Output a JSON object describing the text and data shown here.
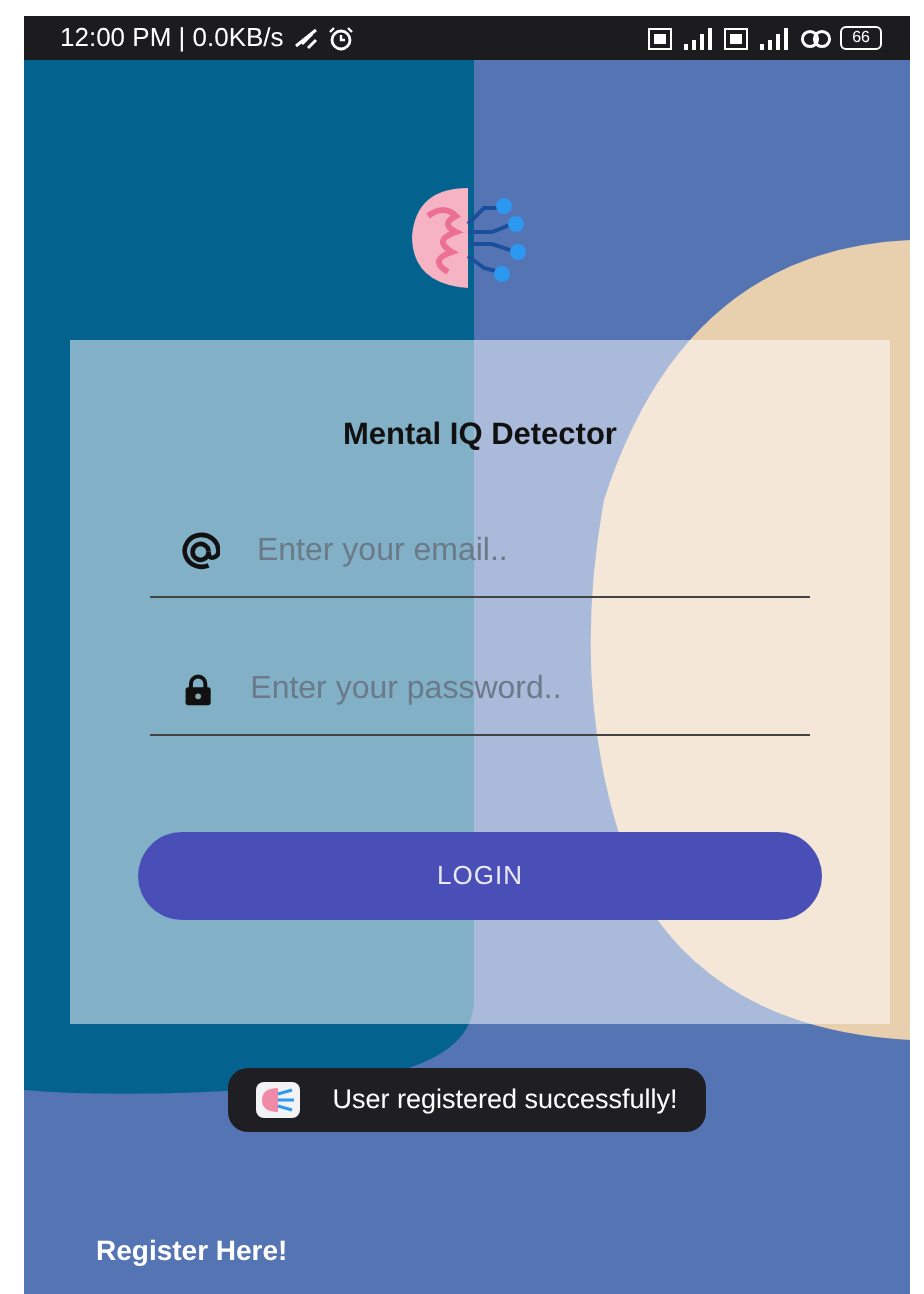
{
  "status_bar": {
    "time": "12:00 PM | 0.0KB/s",
    "battery": "66"
  },
  "app": {
    "title": "Mental IQ Detector"
  },
  "fields": [
    {
      "kind": "email",
      "placeholder": "Enter your email.."
    },
    {
      "kind": "password",
      "placeholder": "Enter your password.."
    }
  ],
  "login_button": "LOGIN",
  "toast": {
    "message": "User registered successfully!"
  },
  "register_link": "Register Here!"
}
